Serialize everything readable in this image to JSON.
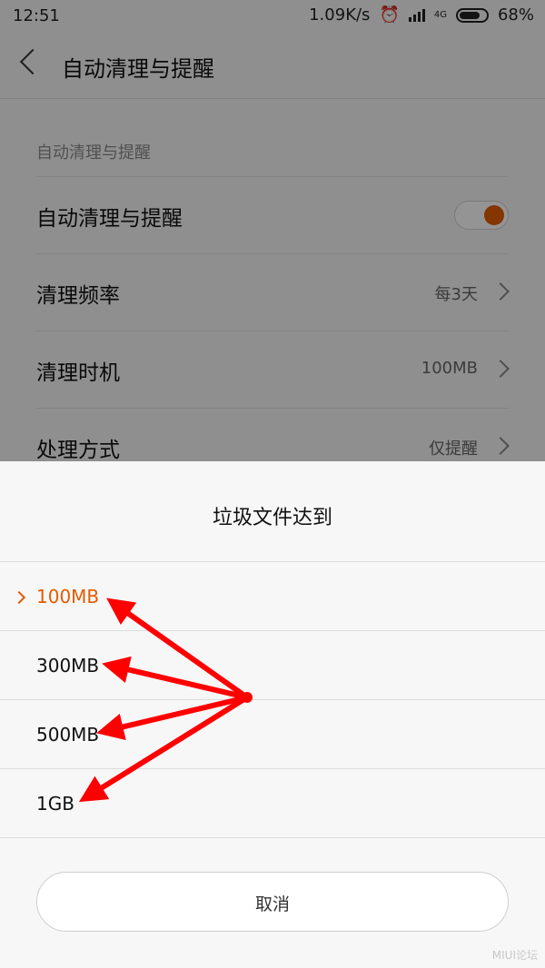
{
  "status_bar": {
    "time": "12:51",
    "speed": "1.09K/s",
    "network": "4G",
    "battery": "68%"
  },
  "header": {
    "title": "自动清理与提醒"
  },
  "settings": {
    "section_label": "自动清理与提醒",
    "toggle_row": {
      "label": "自动清理与提醒",
      "enabled": true
    },
    "rows": [
      {
        "label": "清理频率",
        "value": "每3天"
      },
      {
        "label": "清理时机",
        "value": "100MB"
      },
      {
        "label": "处理方式",
        "value": "仅提醒"
      }
    ]
  },
  "sheet": {
    "title": "垃圾文件达到",
    "options": [
      "100MB",
      "300MB",
      "500MB",
      "1GB"
    ],
    "selected": "100MB",
    "cancel": "取消"
  },
  "colors": {
    "accent": "#e35c00",
    "annotation": "#ff0000"
  },
  "icons": [
    "back-arrow-icon",
    "chevron-right-icon",
    "check-icon",
    "alarm-icon",
    "signal-icon",
    "battery-icon"
  ]
}
